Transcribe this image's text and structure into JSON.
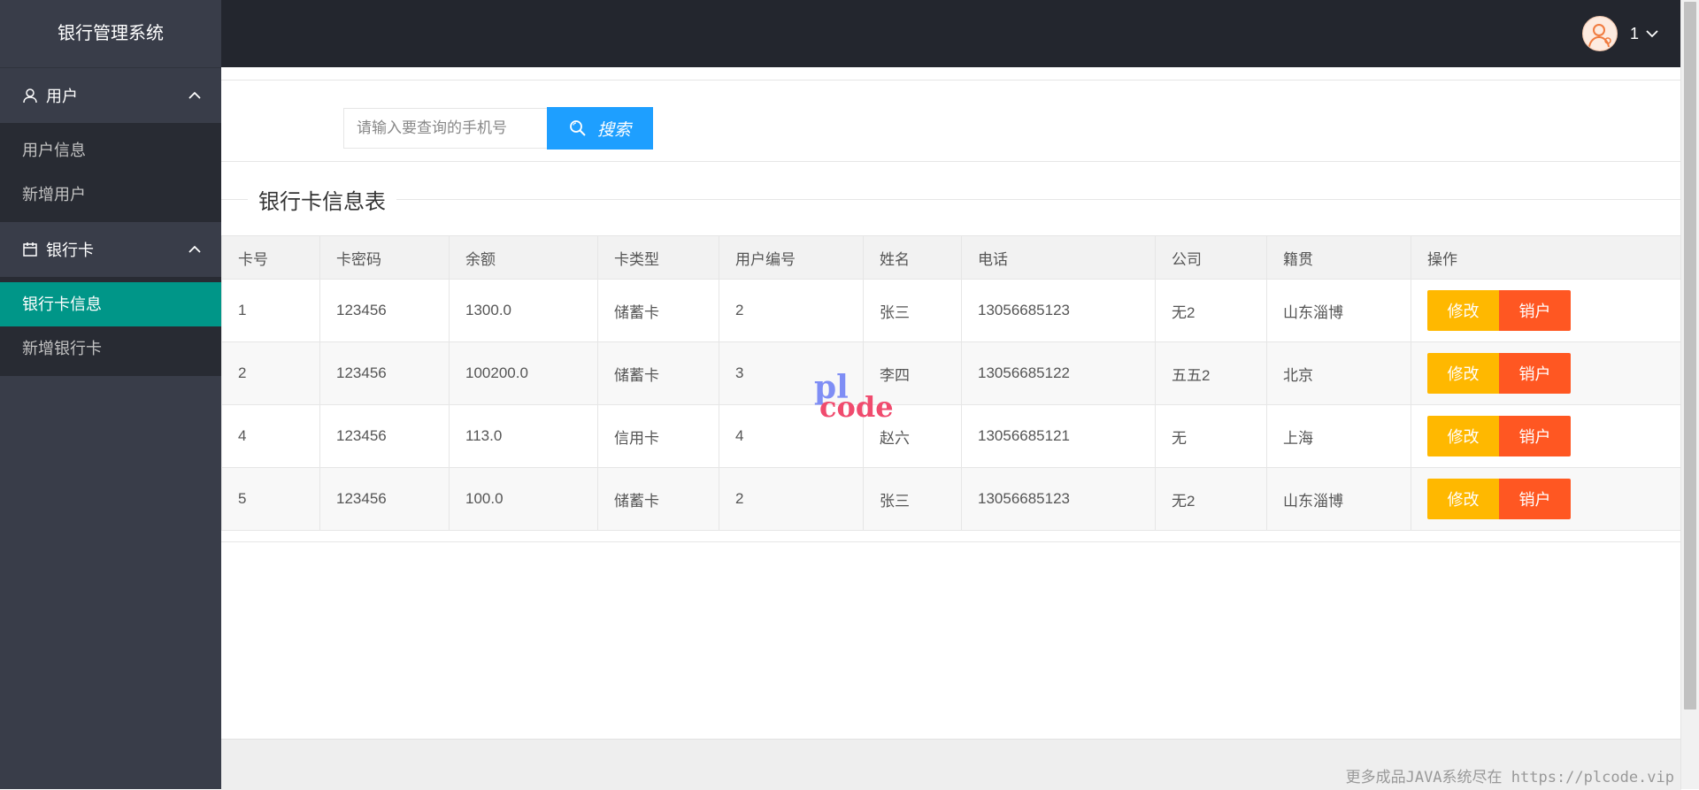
{
  "app": {
    "title": "银行管理系统"
  },
  "sidebar": {
    "groups": [
      {
        "label": "用户",
        "icon": "user-icon",
        "items": [
          {
            "label": "用户信息"
          },
          {
            "label": "新增用户"
          }
        ]
      },
      {
        "label": "银行卡",
        "icon": "calendar-icon",
        "items": [
          {
            "label": "银行卡信息",
            "active": true
          },
          {
            "label": "新增银行卡"
          }
        ]
      }
    ]
  },
  "header": {
    "username": "1"
  },
  "search": {
    "placeholder": "请输入要查询的手机号",
    "value": "",
    "button_label": "搜索"
  },
  "section": {
    "title": "银行卡信息表"
  },
  "table": {
    "columns": [
      "卡号",
      "卡密码",
      "余额",
      "卡类型",
      "用户编号",
      "姓名",
      "电话",
      "公司",
      "籍贯",
      "操作"
    ],
    "rows": [
      [
        "1",
        "123456",
        "1300.0",
        "储蓄卡",
        "2",
        "张三",
        "13056685123",
        "无2",
        "山东淄博"
      ],
      [
        "2",
        "123456",
        "100200.0",
        "储蓄卡",
        "3",
        "李四",
        "13056685122",
        "五五2",
        "北京"
      ],
      [
        "4",
        "123456",
        "113.0",
        "信用卡",
        "4",
        "赵六",
        "13056685121",
        "无",
        "上海"
      ],
      [
        "5",
        "123456",
        "100.0",
        "储蓄卡",
        "2",
        "张三",
        "13056685123",
        "无2",
        "山东淄博"
      ]
    ],
    "actions": {
      "edit": "修改",
      "cancel": "销户"
    }
  },
  "watermark": {
    "top": "pl",
    "bottom": "code"
  },
  "footer": {
    "note": "更多成品JAVA系统尽在 https://plcode.vip"
  },
  "colors": {
    "sidebar": "#393d49",
    "header": "#23262e",
    "active": "#009688",
    "search": "#1e9fff",
    "edit": "#ffb800",
    "cancel": "#ff5722"
  }
}
